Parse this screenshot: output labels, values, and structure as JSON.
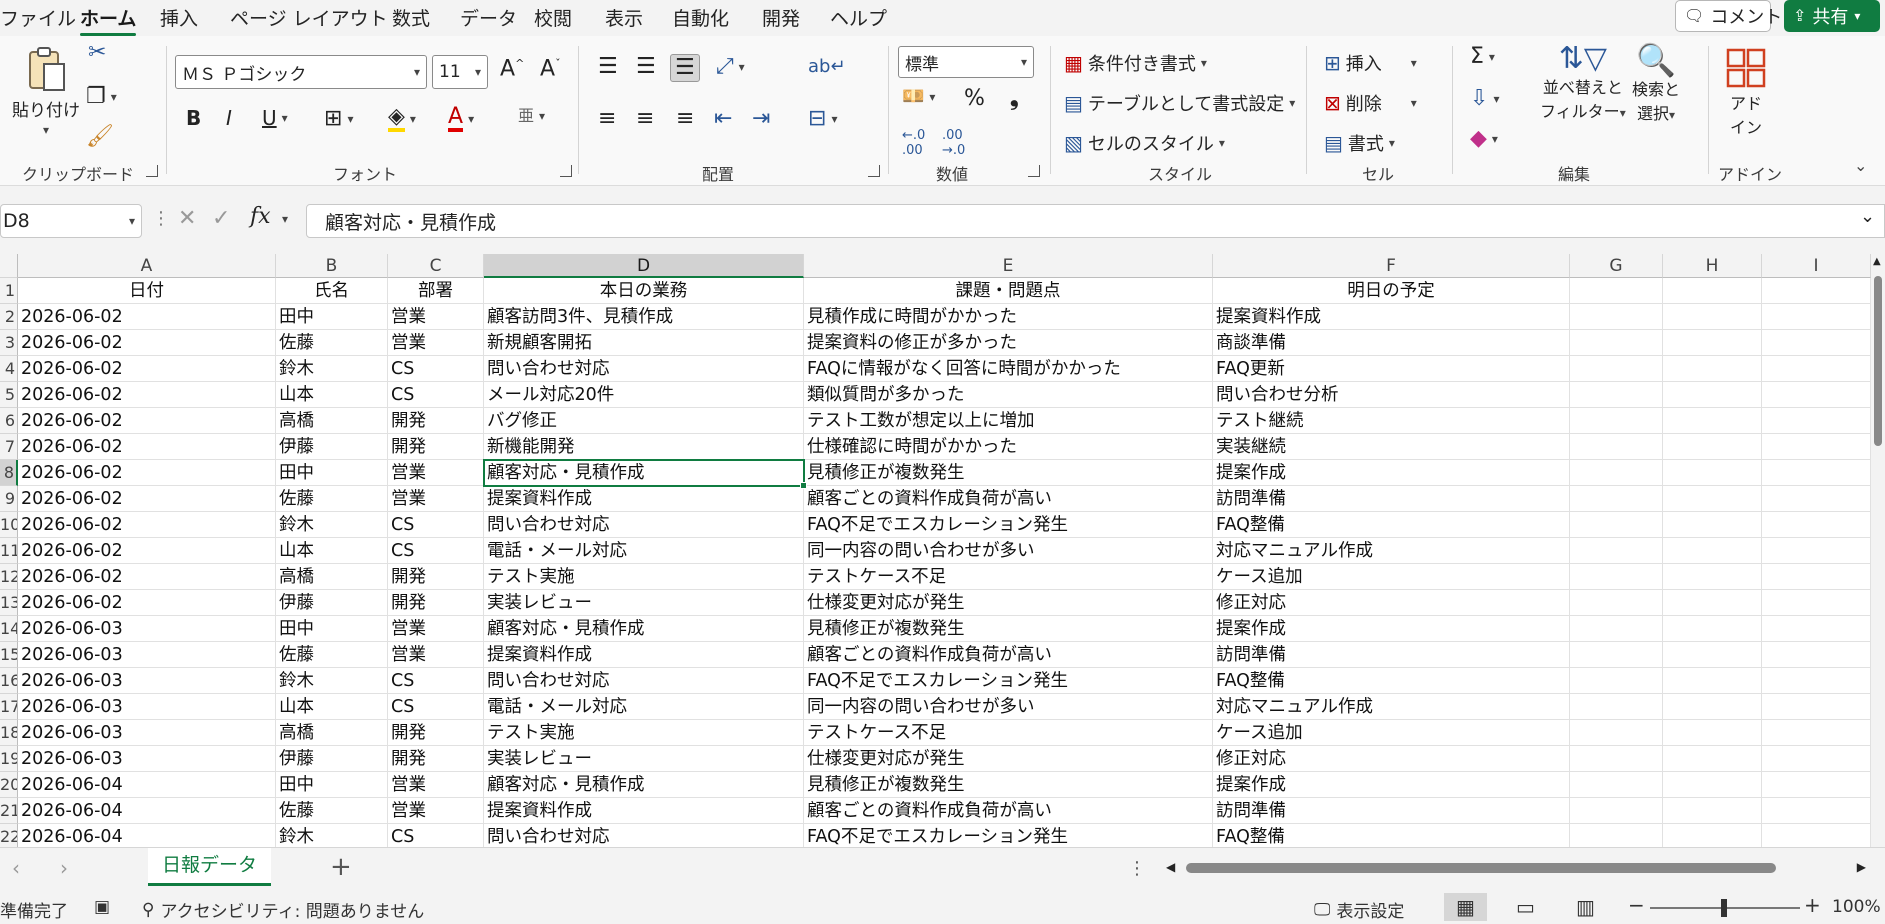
{
  "ribbon_tabs": [
    "ファイル",
    "ホーム",
    "挿入",
    "ページ レイアウト",
    "数式",
    "データ",
    "校閲",
    "表示",
    "自動化",
    "開発",
    "ヘルプ"
  ],
  "active_tab": "ホーム",
  "comment_label": "コメント",
  "share_label": "共有",
  "clipboard": {
    "paste_label": "貼り付け",
    "group_label": "クリップボード"
  },
  "font": {
    "name": "ＭＳ Ｐゴシック",
    "size": "11",
    "group_label": "フォント"
  },
  "alignment": {
    "group_label": "配置"
  },
  "number": {
    "format": "標準",
    "group_label": "数値"
  },
  "styles": {
    "conditional": "条件付き書式",
    "table": "テーブルとして書式設定",
    "cell_styles": "セルのスタイル",
    "group_label": "スタイル"
  },
  "cells": {
    "insert": "挿入",
    "delete": "削除",
    "format": "書式",
    "group_label": "セル"
  },
  "editing": {
    "sort_filter_line1": "並べ替えと",
    "sort_filter_line2": "フィルター",
    "find_line1": "検索と",
    "find_line2": "選択",
    "group_label": "編集"
  },
  "addins": {
    "line1": "アド",
    "line2": "イン",
    "group_label": "アドイン"
  },
  "formula_bar": {
    "name_box": "D8",
    "content": "顧客対応・見積作成"
  },
  "columns": [
    "A",
    "B",
    "C",
    "D",
    "E",
    "F",
    "G",
    "H",
    "I"
  ],
  "row_numbers": [
    "1",
    "2",
    "3",
    "4",
    "5",
    "6",
    "7",
    "8",
    "9",
    "10",
    "11",
    "12",
    "13",
    "14",
    "15",
    "16",
    "17",
    "18",
    "19",
    "20",
    "21",
    "22"
  ],
  "header_row": [
    "日付",
    "氏名",
    "部署",
    "本日の業務",
    "課題・問題点",
    "明日の予定"
  ],
  "rows": [
    [
      "2026-06-02",
      "田中",
      "営業",
      "顧客訪問3件、見積作成",
      "見積作成に時間がかかった",
      "提案資料作成"
    ],
    [
      "2026-06-02",
      "佐藤",
      "営業",
      "新規顧客開拓",
      "提案資料の修正が多かった",
      "商談準備"
    ],
    [
      "2026-06-02",
      "鈴木",
      "CS",
      "問い合わせ対応",
      "FAQに情報がなく回答に時間がかかった",
      "FAQ更新"
    ],
    [
      "2026-06-02",
      "山本",
      "CS",
      "メール対応20件",
      "類似質問が多かった",
      "問い合わせ分析"
    ],
    [
      "2026-06-02",
      "高橋",
      "開発",
      "バグ修正",
      "テスト工数が想定以上に増加",
      "テスト継続"
    ],
    [
      "2026-06-02",
      "伊藤",
      "開発",
      "新機能開発",
      "仕様確認に時間がかかった",
      "実装継続"
    ],
    [
      "2026-06-02",
      "田中",
      "営業",
      "顧客対応・見積作成",
      "見積修正が複数発生",
      "提案作成"
    ],
    [
      "2026-06-02",
      "佐藤",
      "営業",
      "提案資料作成",
      "顧客ごとの資料作成負荷が高い",
      "訪問準備"
    ],
    [
      "2026-06-02",
      "鈴木",
      "CS",
      "問い合わせ対応",
      "FAQ不足でエスカレーション発生",
      "FAQ整備"
    ],
    [
      "2026-06-02",
      "山本",
      "CS",
      "電話・メール対応",
      "同一内容の問い合わせが多い",
      "対応マニュアル作成"
    ],
    [
      "2026-06-02",
      "高橋",
      "開発",
      "テスト実施",
      "テストケース不足",
      "ケース追加"
    ],
    [
      "2026-06-02",
      "伊藤",
      "開発",
      "実装レビュー",
      "仕様変更対応が発生",
      "修正対応"
    ],
    [
      "2026-06-03",
      "田中",
      "営業",
      "顧客対応・見積作成",
      "見積修正が複数発生",
      "提案作成"
    ],
    [
      "2026-06-03",
      "佐藤",
      "営業",
      "提案資料作成",
      "顧客ごとの資料作成負荷が高い",
      "訪問準備"
    ],
    [
      "2026-06-03",
      "鈴木",
      "CS",
      "問い合わせ対応",
      "FAQ不足でエスカレーション発生",
      "FAQ整備"
    ],
    [
      "2026-06-03",
      "山本",
      "CS",
      "電話・メール対応",
      "同一内容の問い合わせが多い",
      "対応マニュアル作成"
    ],
    [
      "2026-06-03",
      "高橋",
      "開発",
      "テスト実施",
      "テストケース不足",
      "ケース追加"
    ],
    [
      "2026-06-03",
      "伊藤",
      "開発",
      "実装レビュー",
      "仕様変更対応が発生",
      "修正対応"
    ],
    [
      "2026-06-04",
      "田中",
      "営業",
      "顧客対応・見積作成",
      "見積修正が複数発生",
      "提案作成"
    ],
    [
      "2026-06-04",
      "佐藤",
      "営業",
      "提案資料作成",
      "顧客ごとの資料作成負荷が高い",
      "訪問準備"
    ],
    [
      "2026-06-04",
      "鈴木",
      "CS",
      "問い合わせ対応",
      "FAQ不足でエスカレーション発生",
      "FAQ整備"
    ]
  ],
  "sheet_tab": "日報データ",
  "status": {
    "ready": "準備完了",
    "accessibility": "アクセシビリティ: 問題ありません",
    "display_settings": "表示設定",
    "zoom": "100%"
  },
  "colors": {
    "accent": "#107c41",
    "grid_line": "#e1e1e1"
  }
}
